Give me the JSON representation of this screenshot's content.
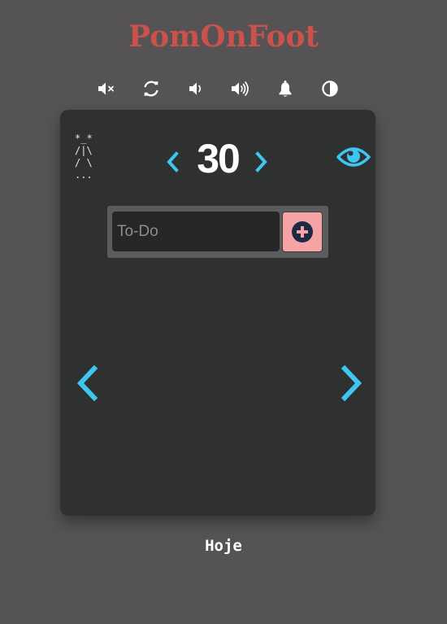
{
  "app": {
    "title": "PomOnFoot"
  },
  "toolbar": {
    "buttons": [
      {
        "icon": "volume-mute-icon"
      },
      {
        "icon": "refresh-icon"
      },
      {
        "icon": "volume-low-icon"
      },
      {
        "icon": "volume-high-icon"
      },
      {
        "icon": "bell-icon"
      },
      {
        "icon": "contrast-icon"
      }
    ]
  },
  "card": {
    "stick_figure": "*_*\n/|\\\n/ \\\n...",
    "timer": {
      "value": "30"
    },
    "todo": {
      "placeholder": "To-Do",
      "value": ""
    }
  },
  "footer": {
    "label": "Hoje"
  },
  "colors": {
    "background": "#555354",
    "card": "#2f3130",
    "title": "#c9524d",
    "accent": "#3ec6f0",
    "add_button": "#f4a4a4",
    "add_icon": "#1e2a45"
  }
}
